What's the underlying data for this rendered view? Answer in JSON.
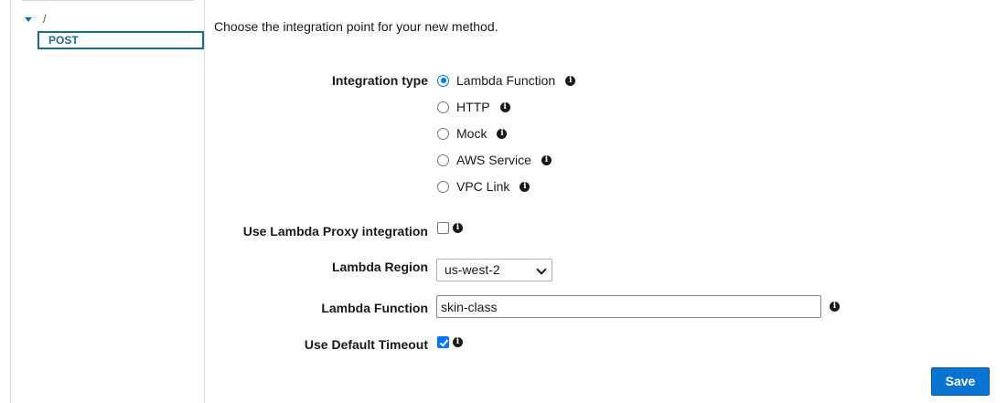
{
  "resource_tree": {
    "root_label": "/",
    "method_label": "POST"
  },
  "intro_text": "Choose the integration point for your new method.",
  "integration_type": {
    "label": "Integration type",
    "selected": "Lambda Function",
    "options": [
      {
        "label": "Lambda Function",
        "checked": true
      },
      {
        "label": "HTTP",
        "checked": false
      },
      {
        "label": "Mock",
        "checked": false
      },
      {
        "label": "AWS Service",
        "checked": false
      },
      {
        "label": "VPC Link",
        "checked": false
      }
    ]
  },
  "lambda_proxy": {
    "label": "Use Lambda Proxy integration",
    "checked": false
  },
  "lambda_region": {
    "label": "Lambda Region",
    "value": "us-west-2"
  },
  "lambda_function": {
    "label": "Lambda Function",
    "value": "skin-class"
  },
  "default_timeout": {
    "label": "Use Default Timeout",
    "checked": true
  },
  "info_icon_glyph": "i",
  "save_label": "Save",
  "colors": {
    "accent": "#0073bb",
    "primary_button": "#0873d0",
    "selected_method": "#1d6b84",
    "control_checked": "#0075ff"
  }
}
